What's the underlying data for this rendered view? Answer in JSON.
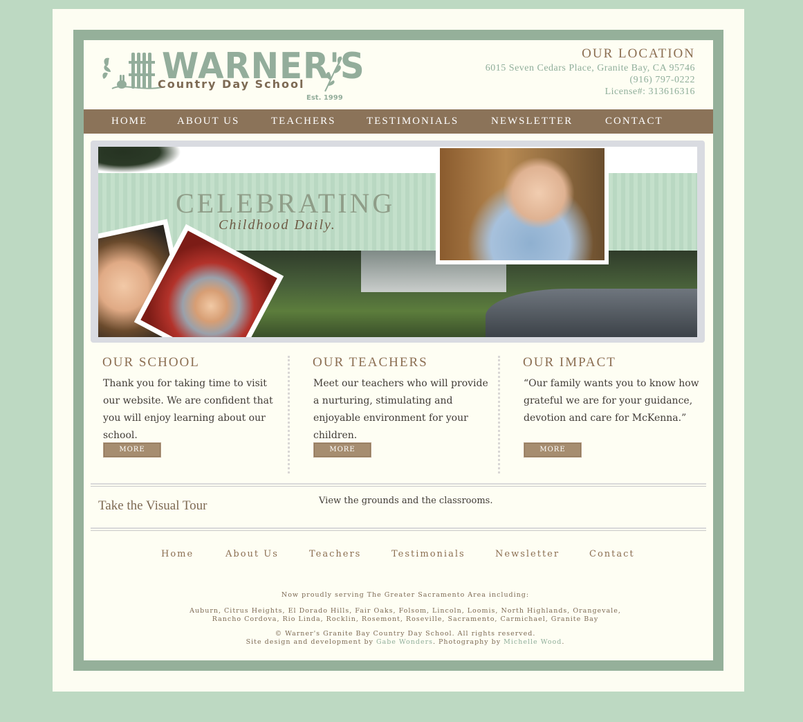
{
  "header": {
    "logo_main": "WARNER'S",
    "logo_sub": "Country Day School",
    "logo_est": "Est. 1999",
    "location_title": "OUR LOCATION",
    "address": "6015 Seven Cedars Place, Granite Bay, CA 95746",
    "phone": "(916) 797-0222",
    "license": "License#: 313616316"
  },
  "nav": [
    "HOME",
    "ABOUT US",
    "TEACHERS",
    "TESTIMONIALS",
    "NEWSLETTER",
    "CONTACT"
  ],
  "hero": {
    "title": "CELEBRATING",
    "subtitle": "Childhood Daily."
  },
  "columns": [
    {
      "title": "OUR SCHOOL",
      "text": "Thank you for taking time to visit our website. We are confident that you will enjoy learning about our school.",
      "button": "MORE"
    },
    {
      "title": "OUR TEACHERS",
      "text": "Meet our teachers who will provide a nurturing, stimulating and enjoyable environment for your children.",
      "button": "MORE"
    },
    {
      "title": "OUR IMPACT",
      "text": "“Our family wants you to know how grateful we are for your guidance, devotion and care for McKenna.”",
      "button": "MORE"
    }
  ],
  "tour": {
    "title": "Take the Visual Tour",
    "text": "View the grounds and the classrooms."
  },
  "footer_nav": [
    "Home",
    "About Us",
    "Teachers",
    "Testimonials",
    "Newsletter",
    "Contact"
  ],
  "footer": {
    "serving": "Now proudly serving The Greater Sacramento Area including:",
    "cities_line1": "Auburn, Citrus Heights, El Dorado Hills, Fair Oaks, Folsom, Lincoln, Loomis, North Highlands, Orangevale,",
    "cities_line2": "Rancho Cordova, Rio Linda, Rocklin, Rosemont, Roseville, Sacramento, Carmichael, Granite Bay",
    "copyright": "© Warner's Granite Bay Country Day School. All rights reserved.",
    "credit_prefix": "Site design and development by ",
    "credit_designer": "Gabe Wonders",
    "credit_mid": ". Photography by ",
    "credit_photographer": "Michelle Wood",
    "credit_suffix": "."
  },
  "colors": {
    "background": "#bdd9c2",
    "frame": "#95b09a",
    "nav_bar": "#8b7359",
    "accent_brown": "#8b6e52",
    "accent_green": "#8fae9a"
  },
  "icons": [
    "logo-fence-icon",
    "logo-vine-icon",
    "logo-bunny-icon"
  ]
}
